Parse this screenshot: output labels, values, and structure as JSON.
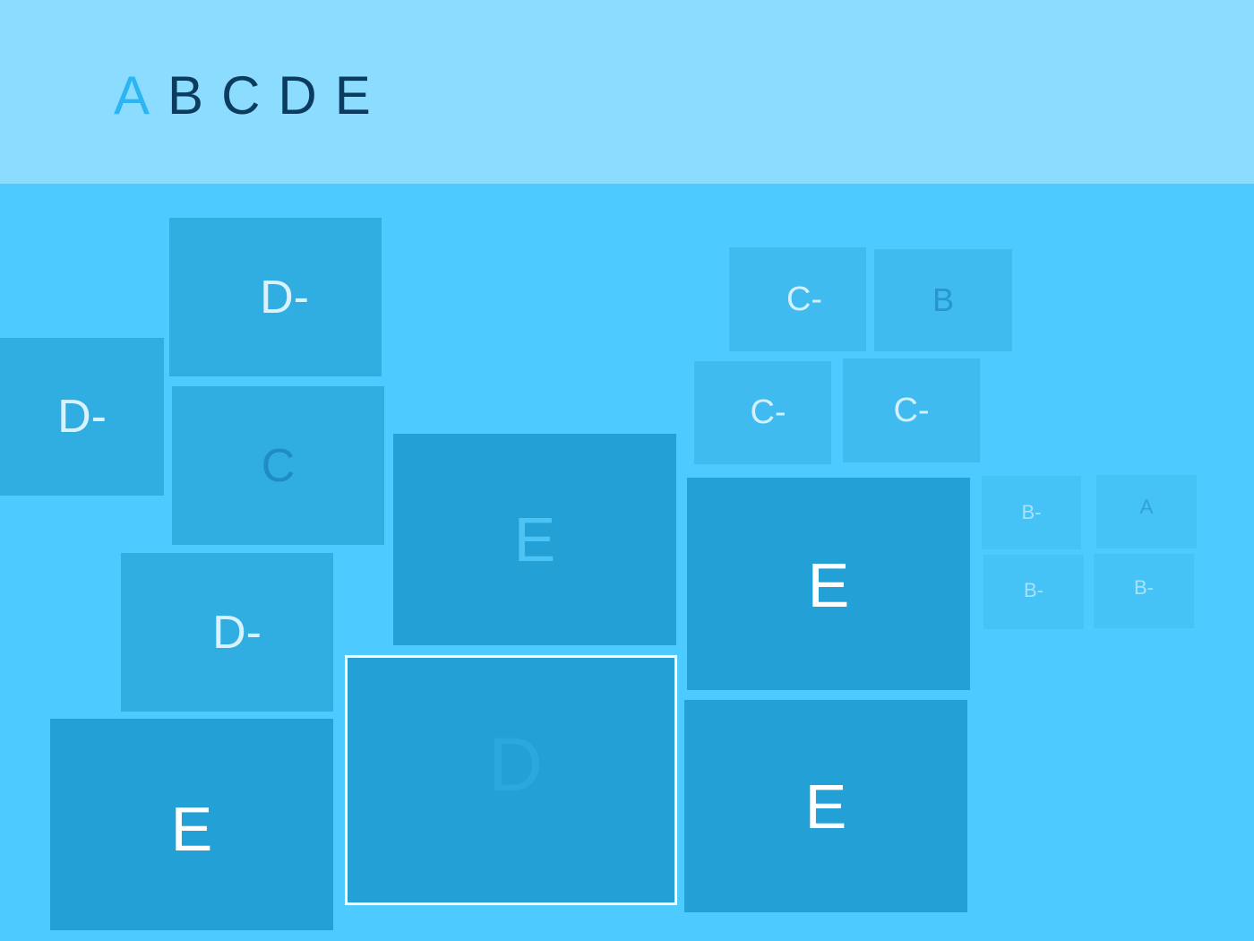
{
  "header": {
    "grades": [
      {
        "label": "A",
        "active": true
      },
      {
        "label": "B",
        "active": false
      },
      {
        "label": "C",
        "active": false
      },
      {
        "label": "D",
        "active": false
      },
      {
        "label": "E",
        "active": false
      }
    ]
  },
  "tiles": [
    {
      "id": "t1",
      "label": "D-",
      "color": "#d8f3ff"
    },
    {
      "id": "t2",
      "label": "D-",
      "color": "#d8f3ff"
    },
    {
      "id": "t3",
      "label": "C",
      "color": "#1f8cc4"
    },
    {
      "id": "t4",
      "label": "D-",
      "color": "#d8f3ff"
    },
    {
      "id": "t5",
      "label": "E",
      "color": "#ffffff"
    },
    {
      "id": "t6",
      "label": "E",
      "color": "#4dc3f3"
    },
    {
      "id": "t7",
      "label": "D",
      "color": "#2aa9e0",
      "selected": true
    },
    {
      "id": "t8",
      "label": "C-",
      "color": "#d2f0ff"
    },
    {
      "id": "t9",
      "label": "B",
      "color": "#2795cf"
    },
    {
      "id": "t10",
      "label": "C-",
      "color": "#d2f0ff"
    },
    {
      "id": "t11",
      "label": "C-",
      "color": "#d2f0ff"
    },
    {
      "id": "t12",
      "label": "E",
      "color": "#ffffff"
    },
    {
      "id": "t13",
      "label": "E",
      "color": "#ffffff"
    },
    {
      "id": "t14",
      "label": "B-",
      "color": "#a8e2fb"
    },
    {
      "id": "t15",
      "label": "A",
      "color": "#2fa2d8"
    },
    {
      "id": "t16",
      "label": "B-",
      "color": "#a8e2fb"
    },
    {
      "id": "t17",
      "label": "B-",
      "color": "#a8e2fb"
    }
  ]
}
